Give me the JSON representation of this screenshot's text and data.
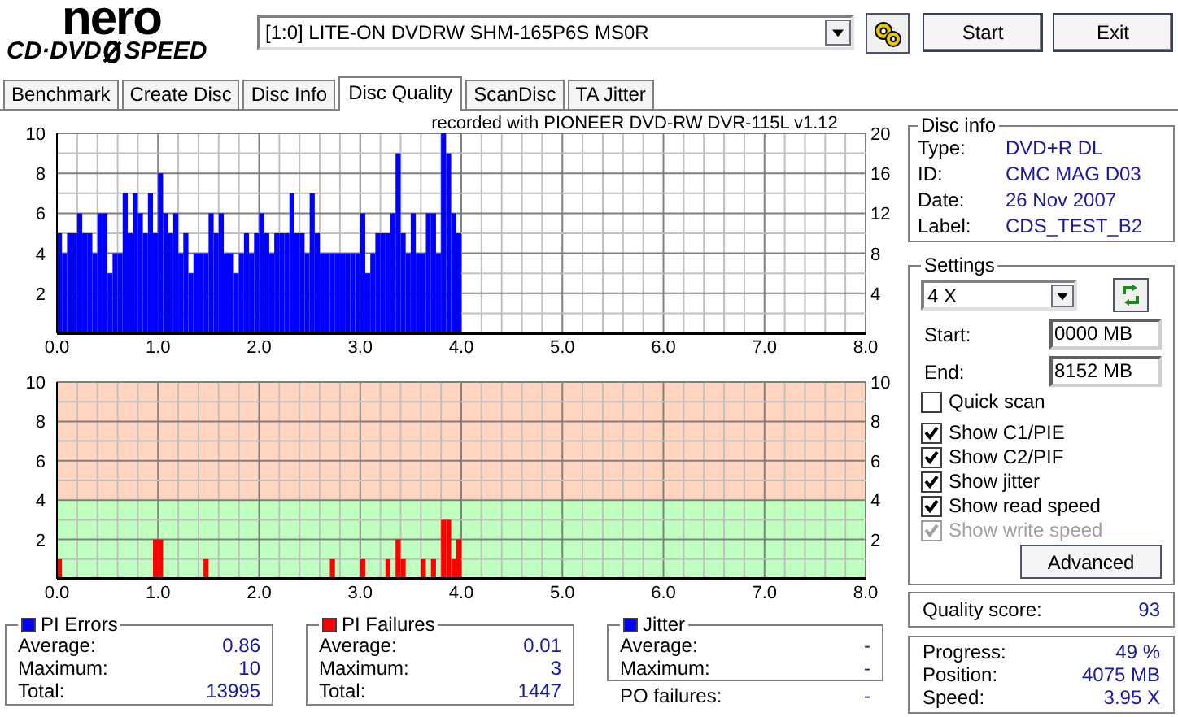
{
  "logo": {
    "top": "nero",
    "left": "CD·DVD",
    "right": "SPEED"
  },
  "drive": {
    "value": "[1:0]  LITE-ON DVDRW SHM-165P6S MS0R"
  },
  "buttons": [
    {
      "label": "Start"
    },
    {
      "label": "Exit"
    }
  ],
  "tabs": [
    {
      "label": "Benchmark",
      "selected": false
    },
    {
      "label": "Create Disc",
      "selected": false
    },
    {
      "label": "Disc Info",
      "selected": false
    },
    {
      "label": "Disc Quality",
      "selected": true
    },
    {
      "label": "ScanDisc",
      "selected": false
    },
    {
      "label": "TA Jitter",
      "selected": false
    }
  ],
  "errors_chart": {
    "right_axis_labels": [
      "20",
      "16",
      "12",
      "8",
      "4"
    ],
    "chart_data": {
      "type": "bar",
      "grid": true,
      "title": "recorded with PIONEER DVD-RW  DVR-115L v1.12",
      "xlim": [
        0,
        8
      ],
      "ylim": [
        0,
        10
      ],
      "xticks": [
        {
          "value": 0,
          "label": "0.0"
        },
        {
          "value": 1,
          "label": "1.0"
        },
        {
          "value": 2,
          "label": "2.0"
        },
        {
          "value": 3,
          "label": "3.0"
        },
        {
          "value": 4,
          "label": "4.0"
        },
        {
          "value": 5,
          "label": "5.0"
        },
        {
          "value": 6,
          "label": "6.0"
        },
        {
          "value": 7,
          "label": "7.0"
        },
        {
          "value": 8,
          "label": "8.0"
        }
      ],
      "yticks": [
        2,
        4,
        6,
        8,
        10
      ],
      "x": [
        0,
        0.05,
        0.1,
        0.15,
        0.2,
        0.25,
        0.3,
        0.35,
        0.4,
        0.45,
        0.5,
        0.55,
        0.6,
        0.65,
        0.7,
        0.75,
        0.8,
        0.85,
        0.9,
        0.95,
        1,
        1.05,
        1.1,
        1.15,
        1.2,
        1.25,
        1.3,
        1.35,
        1.4,
        1.45,
        1.5,
        1.55,
        1.6,
        1.65,
        1.7,
        1.75,
        1.8,
        1.85,
        1.9,
        1.95,
        2,
        2.05,
        2.1,
        2.15,
        2.2,
        2.25,
        2.3,
        2.35,
        2.4,
        2.45,
        2.5,
        2.55,
        2.6,
        2.65,
        2.7,
        2.75,
        2.8,
        2.85,
        2.9,
        2.95,
        3,
        3.05,
        3.1,
        3.15,
        3.2,
        3.25,
        3.3,
        3.35,
        3.4,
        3.45,
        3.5,
        3.55,
        3.6,
        3.65,
        3.7,
        3.75,
        3.8,
        3.85,
        3.9,
        3.95
      ],
      "series": [
        {
          "color": "#0000ff",
          "values": [
            5,
            4,
            5,
            5,
            6,
            5,
            5,
            4,
            6,
            6,
            3,
            4,
            4,
            7,
            5,
            7,
            6,
            5,
            7,
            5,
            8,
            6,
            5,
            6,
            4,
            5,
            3,
            4,
            4,
            4,
            6,
            5,
            6,
            4,
            4,
            3,
            4,
            5,
            4,
            5,
            6,
            5,
            4,
            5,
            5,
            5,
            7,
            5,
            5,
            4,
            7,
            5,
            4,
            4,
            4,
            4,
            4,
            4,
            4,
            4,
            6,
            3,
            4,
            5,
            5,
            5,
            6,
            9,
            5,
            4,
            6,
            4,
            4,
            6,
            6,
            4,
            10,
            9,
            6,
            5
          ]
        }
      ]
    }
  },
  "failures_chart": {
    "right_axis_labels": [
      "10",
      "8",
      "6",
      "4",
      "2"
    ],
    "chart_data": {
      "type": "bar",
      "grid": true,
      "bands": [
        {
          "axis": "y",
          "from": 4,
          "to": 10,
          "color": "#ffd5bf"
        },
        {
          "axis": "y",
          "from": 0,
          "to": 4,
          "color": "#bfffbf"
        }
      ],
      "xlim": [
        0,
        8
      ],
      "ylim": [
        0,
        10
      ],
      "xticks": [
        {
          "value": 0,
          "label": "0.0"
        },
        {
          "value": 1,
          "label": "1.0"
        },
        {
          "value": 2,
          "label": "2.0"
        },
        {
          "value": 3,
          "label": "3.0"
        },
        {
          "value": 4,
          "label": "4.0"
        },
        {
          "value": 5,
          "label": "5.0"
        },
        {
          "value": 6,
          "label": "6.0"
        },
        {
          "value": 7,
          "label": "7.0"
        },
        {
          "value": 8,
          "label": "8.0"
        }
      ],
      "yticks": [
        {
          "value": 2,
          "label": "2"
        },
        {
          "value": 4,
          "label": "4"
        },
        {
          "value": 6,
          "label": "6"
        },
        {
          "value": 8,
          "label": "8"
        },
        {
          "value": 10,
          "label": "10"
        }
      ],
      "x": [
        0,
        0.05,
        0.1,
        0.15,
        0.2,
        0.25,
        0.3,
        0.35,
        0.4,
        0.45,
        0.5,
        0.55,
        0.6,
        0.65,
        0.7,
        0.75,
        0.8,
        0.85,
        0.9,
        0.95,
        1,
        1.05,
        1.1,
        1.15,
        1.2,
        1.25,
        1.3,
        1.35,
        1.4,
        1.45,
        1.5,
        1.55,
        1.6,
        1.65,
        1.7,
        1.75,
        1.8,
        1.85,
        1.9,
        1.95,
        2,
        2.05,
        2.1,
        2.15,
        2.2,
        2.25,
        2.3,
        2.35,
        2.4,
        2.45,
        2.5,
        2.55,
        2.6,
        2.65,
        2.7,
        2.75,
        2.8,
        2.85,
        2.9,
        2.95,
        3,
        3.05,
        3.1,
        3.15,
        3.2,
        3.25,
        3.3,
        3.35,
        3.4,
        3.45,
        3.5,
        3.55,
        3.6,
        3.65,
        3.7,
        3.75,
        3.8,
        3.85,
        3.9,
        3.95
      ],
      "series": [
        {
          "color": "#ff0000",
          "values": [
            1,
            0,
            0,
            0,
            0,
            0,
            0,
            0,
            0,
            0,
            0,
            0,
            0,
            0,
            0,
            0,
            0,
            0,
            0,
            2,
            2,
            0,
            0,
            0,
            0,
            0,
            0,
            0,
            0,
            1,
            0,
            0,
            0,
            0,
            0,
            0,
            0,
            0,
            0,
            0,
            0,
            0,
            0,
            0,
            0,
            0,
            0,
            0,
            0,
            0,
            0,
            0,
            0,
            0,
            1,
            0,
            0,
            0,
            0,
            0,
            1,
            0,
            0,
            0,
            0,
            1,
            0,
            2,
            1,
            0,
            0,
            0,
            1,
            0,
            1,
            0,
            3,
            3,
            1,
            2
          ]
        }
      ]
    }
  },
  "stats": [
    {
      "title": "PI Errors",
      "color": "#0000ff",
      "rows": [
        {
          "label": "Average:",
          "value": "0.86"
        },
        {
          "label": "Maximum:",
          "value": "10"
        },
        {
          "label": "Total:",
          "value": "13995"
        }
      ]
    },
    {
      "title": "PI Failures",
      "color": "#ff0000",
      "rows": [
        {
          "label": "Average:",
          "value": "0.01"
        },
        {
          "label": "Maximum:",
          "value": "3"
        },
        {
          "label": "Total:",
          "value": "1447"
        }
      ]
    },
    {
      "title": "Jitter",
      "color": "#0000ff",
      "rows": [
        {
          "label": "Average:",
          "value": "-"
        },
        {
          "label": "Maximum:",
          "value": "-"
        }
      ],
      "extra": {
        "label": "PO failures:",
        "value": "-"
      }
    }
  ],
  "disc_info": {
    "title": "Disc info",
    "rows": [
      {
        "label": "Type:",
        "value": "DVD+R DL"
      },
      {
        "label": "ID:",
        "value": "CMC MAG D03"
      },
      {
        "label": "Date:",
        "value": "26 Nov 2007"
      },
      {
        "label": "Label:",
        "value": "CDS_TEST_B2"
      }
    ]
  },
  "settings": {
    "title": "Settings",
    "speed": "4 X",
    "fields": [
      {
        "label": "Start:",
        "value": "0000 MB"
      },
      {
        "label": "End:",
        "value": "8152 MB"
      }
    ],
    "checkboxes": [
      {
        "label": "Quick scan",
        "checked": false,
        "disabled": false
      },
      {
        "label": "Show C1/PIE",
        "checked": true,
        "disabled": false
      },
      {
        "label": "Show C2/PIF",
        "checked": true,
        "disabled": false
      },
      {
        "label": "Show jitter",
        "checked": true,
        "disabled": false
      },
      {
        "label": "Show read speed",
        "checked": true,
        "disabled": false
      },
      {
        "label": "Show write speed",
        "checked": true,
        "disabled": true
      }
    ],
    "button": "Advanced"
  },
  "quality": {
    "label": "Quality score:",
    "value": "93"
  },
  "progress": [
    {
      "label": "Progress:",
      "value": "49 %"
    },
    {
      "label": "Position:",
      "value": "4075 MB"
    },
    {
      "label": "Speed:",
      "value": "3.95 X"
    }
  ]
}
